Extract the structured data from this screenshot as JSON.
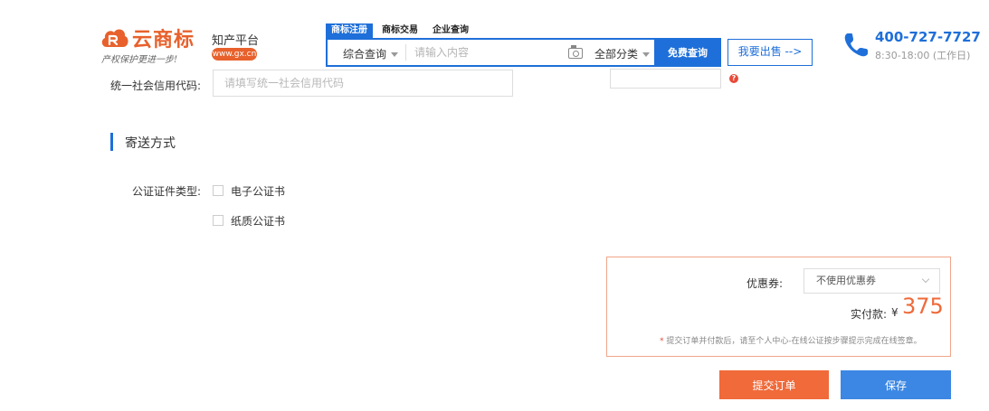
{
  "header": {
    "logo_text": "云商标",
    "slogan": "产权保护更进一步!",
    "platform": "知产平台",
    "web_badge": "www.gx.cn",
    "search_tabs": [
      "商标注册",
      "商标交易",
      "企业查询"
    ],
    "search_type": "综合查询",
    "search_placeholder": "请输入内容",
    "category": "全部分类",
    "search_button": "免费查询",
    "sell_button": "我要出售 -->",
    "phone": "400-727-7727",
    "hours": "8:30-18:00 (工作日)"
  },
  "form": {
    "credit_code_label": "统一社会信用代码:",
    "credit_code_placeholder": "请填写统一社会信用代码",
    "help_glyph": "?"
  },
  "shipping": {
    "title": "寄送方式",
    "cert_type_label": "公证证件类型:",
    "options": [
      "电子公证书",
      "纸质公证书"
    ]
  },
  "payment": {
    "coupon_label": "优惠券:",
    "coupon_value": "不使用优惠券",
    "amount_label": "实付款:",
    "currency": "¥",
    "amount": "375",
    "note_star": "*",
    "note": "提交订单并付款后，请至个人中心-在线公证按步骤提示完成在线签章。"
  },
  "actions": {
    "submit": "提交订单",
    "save": "保存"
  },
  "colors": {
    "brand_blue": "#1e6fd9",
    "accent_orange": "#f06a3a",
    "save_blue": "#3b87e3"
  }
}
